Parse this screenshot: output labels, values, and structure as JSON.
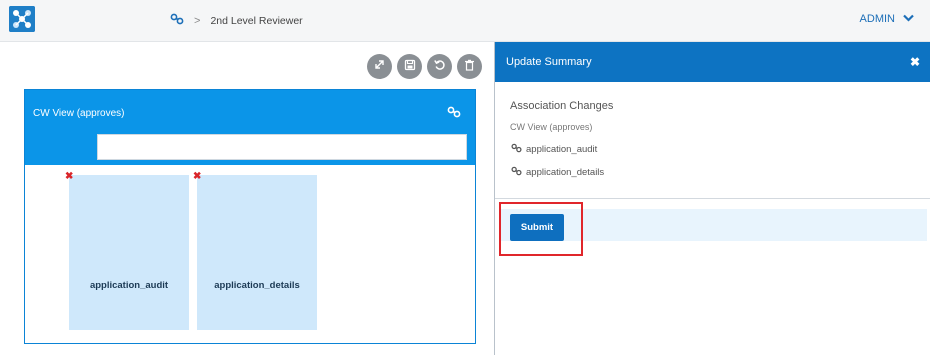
{
  "topbar": {
    "breadcrumb_separator": ">",
    "breadcrumb_label": "2nd Level Reviewer",
    "user_label": "ADMIN"
  },
  "canvas": {
    "toolbar_icons": [
      "expand-icon",
      "save-icon",
      "undo-icon",
      "delete-icon"
    ],
    "view": {
      "title": "CW View (approves)",
      "search_value": "",
      "cards": [
        {
          "label": "application_audit"
        },
        {
          "label": "application_details"
        }
      ]
    }
  },
  "panel": {
    "title": "Update Summary",
    "section_title": "Association Changes",
    "view_name": "CW View (approves)",
    "items": [
      "application_audit",
      "application_details"
    ],
    "submit_label": "Submit"
  },
  "colors": {
    "accent": "#0b95e8",
    "panel_header": "#0d73c2",
    "card": "#cfe8fb",
    "remove": "#d9252a",
    "highlight": "#e0262b"
  }
}
